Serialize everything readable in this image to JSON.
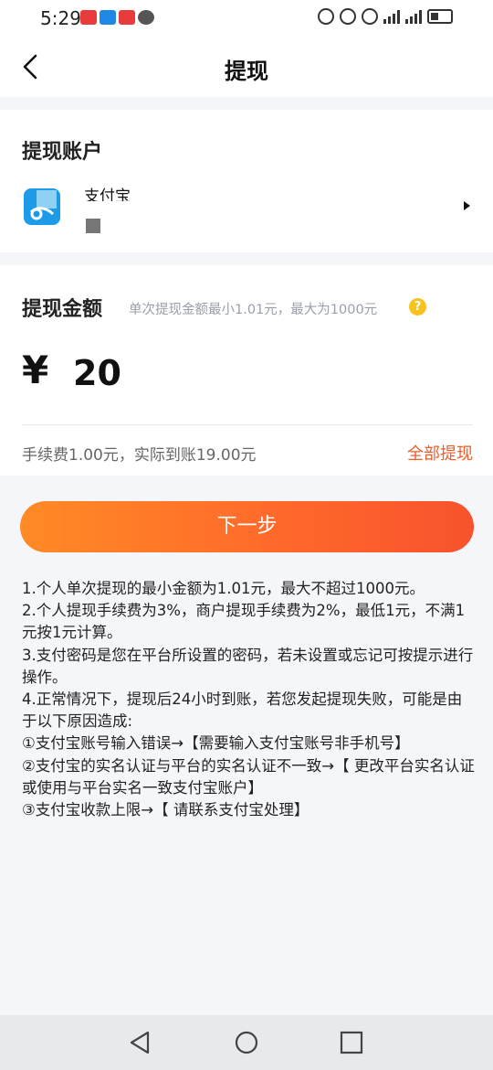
{
  "status_bar": {
    "time": "5:29",
    "app_icons": [
      "#e83b3b",
      "#1e88e5",
      "#e83b3b",
      "#555555"
    ]
  },
  "header": {
    "title": "提现"
  },
  "account": {
    "heading": "提现账户",
    "name": "支付宝",
    "logo_color": "#1e9be8"
  },
  "amount": {
    "heading": "提现金额",
    "hint": "单次提现金额最小1.01元，最大为1000元",
    "help_icon": "?",
    "currency": "¥",
    "value": "20",
    "fee_text": "手续费1.00元，实际到账19.00元",
    "withdraw_all": "全部提现"
  },
  "next_button": "下一步",
  "notes": [
    "1.个人单次提现的最小金额为1.01元，最大不超过1000元。",
    "2.个人提现手续费为3%，商户提现手续费为2%，最低1元，不满1元按1元计算。",
    "3.支付密码是您在平台所设置的密码，若未设置或忘记可按提示进行操作。",
    "4.正常情况下，提现后24小时到账，若您发起提现失败，可能是由于以下原因造成:",
    "①支付宝账号输入错误→【需要输入支付宝账号非手机号】",
    "②支付宝的实名认证与平台的实名认证不一致→【 更改平台实名认证或使用与平台实名一致支付宝账户】",
    "③支付宝收款上限→【 请联系支付宝处理】"
  ],
  "colors": {
    "accent": "#f35b2a",
    "button_start": "#ff8a26",
    "button_end": "#f7522c",
    "help_yellow": "#f7c21d"
  }
}
